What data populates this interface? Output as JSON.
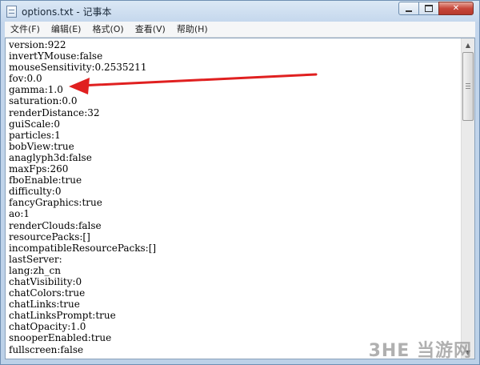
{
  "window": {
    "title": "options.txt - 记事本",
    "buttons": {
      "minimize": "",
      "maximize": "",
      "close": "✕"
    }
  },
  "menu": [
    "文件(F)",
    "编辑(E)",
    "格式(O)",
    "查看(V)",
    "帮助(H)"
  ],
  "document": {
    "lines": [
      "version:922",
      "invertYMouse:false",
      "mouseSensitivity:0.2535211",
      "fov:0.0",
      "gamma:1.0",
      "saturation:0.0",
      "renderDistance:32",
      "guiScale:0",
      "particles:1",
      "bobView:true",
      "anaglyph3d:false",
      "maxFps:260",
      "fboEnable:true",
      "difficulty:0",
      "fancyGraphics:true",
      "ao:1",
      "renderClouds:false",
      "resourcePacks:[]",
      "incompatibleResourcePacks:[]",
      "lastServer:",
      "lang:zh_cn",
      "chatVisibility:0",
      "chatColors:true",
      "chatLinks:true",
      "chatLinksPrompt:true",
      "chatOpacity:1.0",
      "snooperEnabled:true",
      "fullscreen:false"
    ]
  },
  "scrollbar": {
    "thumb_position": 0.0,
    "visible_fraction": 0.23
  },
  "annotation": {
    "color": "#e02020",
    "points_to_line": "gamma:1.0"
  },
  "watermark": {
    "text": "3HE 当游网"
  }
}
